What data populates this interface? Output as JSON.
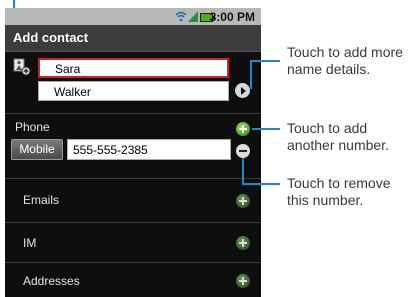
{
  "status_bar": {
    "time": "3:00 PM",
    "icons": [
      "wifi-icon",
      "signal-icon",
      "battery-icon"
    ]
  },
  "screen_title": "Add contact",
  "name": {
    "first": "Sara",
    "last": "Walker"
  },
  "phone_section": {
    "label": "Phone",
    "type": "Mobile",
    "number": "555-555-2385"
  },
  "sections": [
    {
      "label": "Emails"
    },
    {
      "label": "IM"
    },
    {
      "label": "Addresses"
    }
  ],
  "callouts": {
    "name_details": [
      "Touch to add more",
      "name details."
    ],
    "add_number": [
      "Touch to add",
      "another number."
    ],
    "remove_number": [
      "Touch to remove",
      "this number."
    ]
  },
  "colors": {
    "callout_line": "#1a8ac8",
    "focus_border": "#d22020",
    "add_button": "#4c9a24"
  }
}
